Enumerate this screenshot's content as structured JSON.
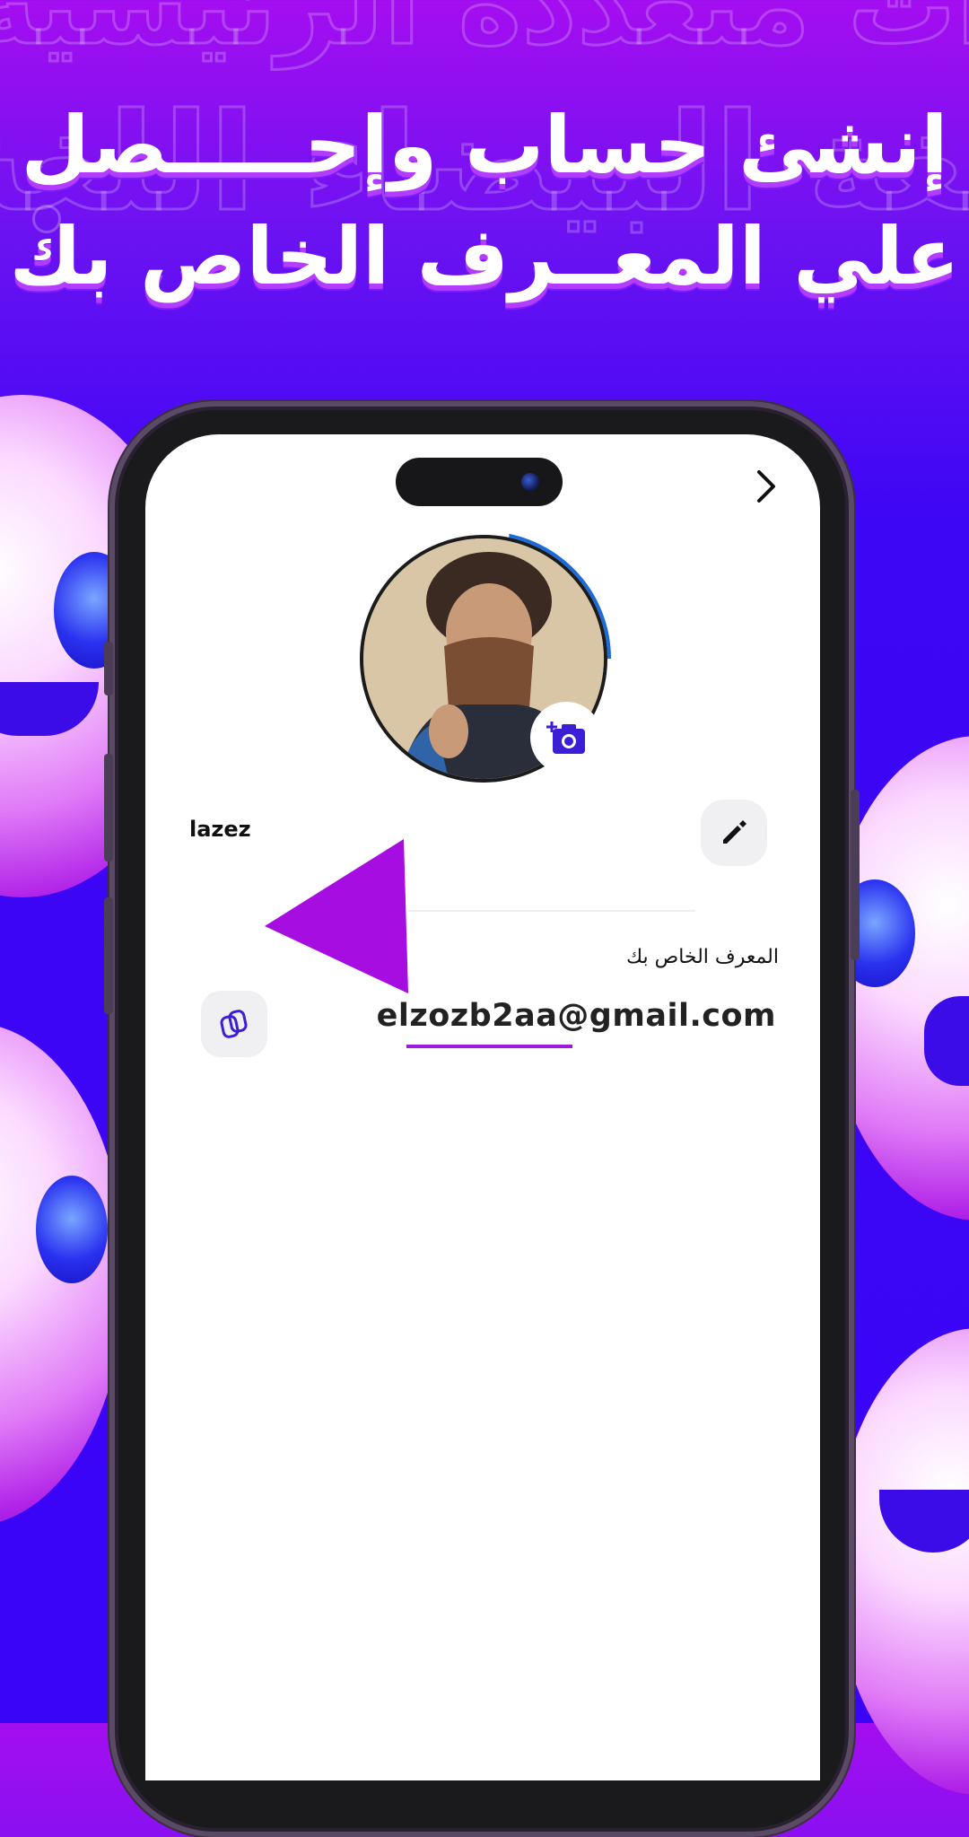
{
  "promo": {
    "headline_line1": "إنشئ حساب وإحـــــصل",
    "headline_line2": "علي المعــرف الخاص بك"
  },
  "profile": {
    "username": "lazez",
    "id_label": "المعرف الخاص بك",
    "id_value": "elzozb2aa@gmail.com"
  },
  "icons": {
    "back": "chevron-right-icon",
    "camera": "add-photo-icon",
    "edit": "pencil-icon",
    "copy": "copy-icon",
    "pointer": "triangle-pointer-icon"
  },
  "colors": {
    "accent": "#9d1bdc",
    "icon_blue": "#3b1fd6",
    "background_top": "#a40ef0",
    "background_bottom": "#3a04f6"
  }
}
